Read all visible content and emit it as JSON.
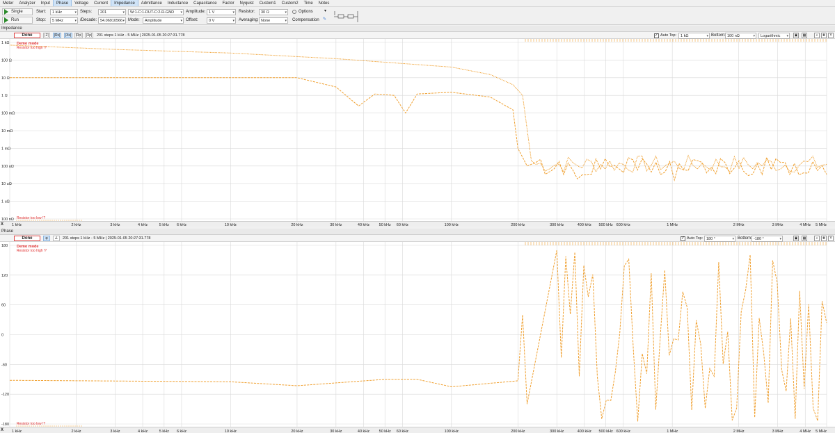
{
  "menu": [
    "Meter",
    "Analyzer",
    "Input",
    "Phase",
    "Voltage",
    "Current",
    "Impedance",
    "Admittance",
    "Inductance",
    "Capacitance",
    "Factor",
    "Nyquist",
    "Custom1",
    "Custom2",
    "Time",
    "Notes"
  ],
  "menu_active": [
    "Phase",
    "Impedance"
  ],
  "toolbar": {
    "single": "Single",
    "run": "Run",
    "start_label": "Start:",
    "start_value": "1 kHz",
    "stop_label": "Stop:",
    "stop_value": "5 MHz",
    "steps_label": "Steps:",
    "steps_value": "201",
    "decade_label": "/Decade:",
    "decade_value": "54.06910566",
    "circuit_value": "W:1-C:1-DUT-C:2-R-GND",
    "mode_label": "Mode:",
    "mode_value": "Amplitude",
    "amplitude_label": "Amplitude:",
    "amplitude_value": "1 V",
    "offset_label": "Offset:",
    "offset_value": "0 V",
    "resistor_label": "Resistor:",
    "resistor_value": "30 Ω",
    "averaging_label": "Averaging:",
    "averaging_value": "None",
    "options_label": "Options",
    "compensation_label": "Compensation"
  },
  "impedance_panel": {
    "title": "Impedance",
    "done": "Done",
    "buttons": [
      "|Z|",
      "|Rs|",
      "|Xs|",
      "|Rp|",
      "|Xp|"
    ],
    "info": "201 steps 1 kHz - 5 MHz | 2025-01-05 20:27:31.778",
    "auto_top": "Auto Top:",
    "top_value": "1 kΩ",
    "bottom_label": "Bottom:",
    "bottom_value": "100 nΩ",
    "scale_value": "Logarithmic",
    "demo": "Demo mode",
    "warn_high": "Resistor too high !?",
    "warn_low": "Resistor too low !?",
    "yticks": [
      "1 kΩ",
      "100 Ω",
      "10 Ω",
      "1 Ω",
      "100 mΩ",
      "10 mΩ",
      "1 mΩ",
      "100 uΩ",
      "10 uΩ",
      "1 uΩ",
      "100 nΩ"
    ]
  },
  "phase_panel": {
    "title": "Phase",
    "done": "Done",
    "buttons": [
      "φ",
      "∠"
    ],
    "info": "201 steps 1 kHz - 5 MHz | 2025-01-05 20:27:31.778",
    "auto_top": "Auto Top:",
    "top_value": "180 °",
    "bottom_label": "Bottom:",
    "bottom_value": "-180 °",
    "demo": "Demo mode",
    "warn_high": "Resistor too high !?",
    "warn_low": "Resistor too low !?",
    "yticks": [
      "180",
      "120",
      "60",
      "0",
      "-60",
      "-120",
      "-180"
    ]
  },
  "x_axis": {
    "label": "X",
    "ticks": [
      "1 kHz",
      "2 kHz",
      "3 kHz",
      "4 kHz",
      "5 kHz",
      "6 kHz",
      "10 kHz",
      "20 kHz",
      "30 kHz",
      "40 kHz",
      "50 kHz",
      "60 kHz",
      "100 kHz",
      "200 kHz",
      "300 kHz",
      "400 kHz",
      "500 kHz",
      "600 kHz",
      "1 MHz",
      "2 MHz",
      "3 MHz",
      "4 MHz",
      "5 MHz"
    ]
  },
  "colors": {
    "trace": "#f0a030",
    "warn": "#e03030",
    "grid": "#d9d9d9"
  },
  "chart_data": [
    {
      "type": "line",
      "title": "Impedance",
      "x_scale": "log",
      "y_scale": "log",
      "xlim": [
        "1 kHz",
        "5 MHz"
      ],
      "ylim": [
        "100 nΩ",
        "1 kΩ"
      ],
      "series": [
        {
          "values_approx": [
            [
              1000,
              700
            ],
            [
              3000,
              400
            ],
            [
              10000,
              250
            ],
            [
              30000,
              120
            ],
            [
              100000,
              40
            ],
            [
              150000,
              15
            ],
            [
              190000,
              4
            ],
            [
              210000,
              1
            ],
            [
              230000,
              0.0002
            ]
          ]
        },
        {
          "values_approx": [
            [
              1000,
              10
            ],
            [
              20000,
              10
            ],
            [
              30000,
              3
            ],
            [
              38000,
              0.25
            ],
            [
              45000,
              1.2
            ],
            [
              55000,
              1.0
            ],
            [
              62000,
              0.1
            ],
            [
              70000,
              1.2
            ],
            [
              100000,
              1.5
            ],
            [
              150000,
              0.8
            ],
            [
              190000,
              0.15
            ],
            [
              200000,
              0.001
            ],
            [
              220000,
              0.0001
            ]
          ]
        }
      ]
    },
    {
      "type": "line",
      "title": "Phase",
      "x_scale": "log",
      "ylim": [
        -180,
        180
      ],
      "series": [
        {
          "values_approx": [
            [
              1000,
              -92
            ],
            [
              10000,
              -95
            ],
            [
              20000,
              -103
            ],
            [
              50000,
              -90
            ],
            [
              70000,
              -90
            ],
            [
              100000,
              -105
            ],
            [
              200000,
              -93
            ],
            [
              210000,
              40
            ],
            [
              220000,
              -140
            ],
            [
              300000,
              170
            ]
          ]
        }
      ]
    }
  ]
}
